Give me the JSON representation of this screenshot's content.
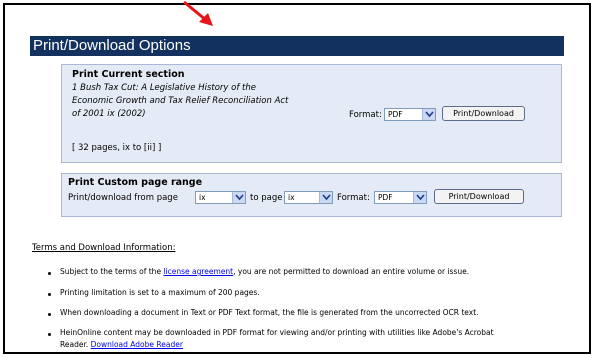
{
  "header": {
    "title": "Print/Download Options"
  },
  "current_section": {
    "title": "Print Current section",
    "citation_lines": [
      "1 Bush Tax Cut: A Legislative History of the",
      "Economic Growth and Tax Relief Reconciliation Act",
      "of 2001 ix (2002)"
    ],
    "pages_info": "[ 32 pages, ix to [ii] ]",
    "format_label": "Format:",
    "format_value": "PDF",
    "button_label": "Print/Download"
  },
  "custom_range": {
    "title": "Print Custom page range",
    "from_label": "Print/download from page",
    "from_value": "ix",
    "to_label": "to page",
    "to_value": "ix",
    "format_label": "Format:",
    "format_value": "PDF",
    "button_label": "Print/Download"
  },
  "terms": {
    "heading": "Terms and Download Information:",
    "bullets": {
      "b1_pre": "Subject to the terms of the ",
      "b1_link": "license agreement",
      "b1_post": ", you are not permitted to download an entire volume or issue.",
      "b2": "Printing limitation is set to a maximum of 200 pages.",
      "b3": "When downloading a document in Text or PDF Text format, the file is generated from the uncorrected OCR text.",
      "b4_line1": "HeinOnline content may be downloaded in PDF format for viewing and/or printing with utilities like Adobe's Acrobat",
      "b4_line2_pre": "Reader. ",
      "b4_link": "Download Adobe Reader"
    }
  },
  "colors": {
    "header_bg": "#13315f",
    "section_bg": "#e5ebf6",
    "annotation_arrow": "#e8141b",
    "link": "#0000ee"
  },
  "icons": {
    "dropdown": "chevron-down-icon",
    "annotation": "red-arrow-icon"
  }
}
